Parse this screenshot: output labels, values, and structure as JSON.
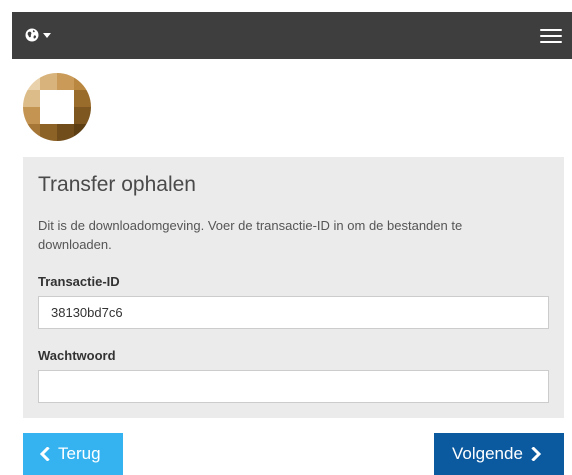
{
  "navbar": {
    "language_icon": "globe-icon",
    "menu_icon": "hamburger-menu-icon"
  },
  "panel": {
    "title": "Transfer ophalen",
    "description": "Dit is de downloadomgeving. Voer de transactie-ID in om de bestanden te downloaden."
  },
  "fields": {
    "transaction_id": {
      "label": "Transactie-ID",
      "value": "38130bd7c6"
    },
    "password": {
      "label": "Wachtwoord",
      "value": ""
    }
  },
  "buttons": {
    "back_label": "Terug",
    "next_label": "Volgende"
  },
  "colors": {
    "navbar": "#3e3e3e",
    "panel": "#ebebeb",
    "back_button": "#35b3f0",
    "next_button": "#0b5aa0"
  }
}
